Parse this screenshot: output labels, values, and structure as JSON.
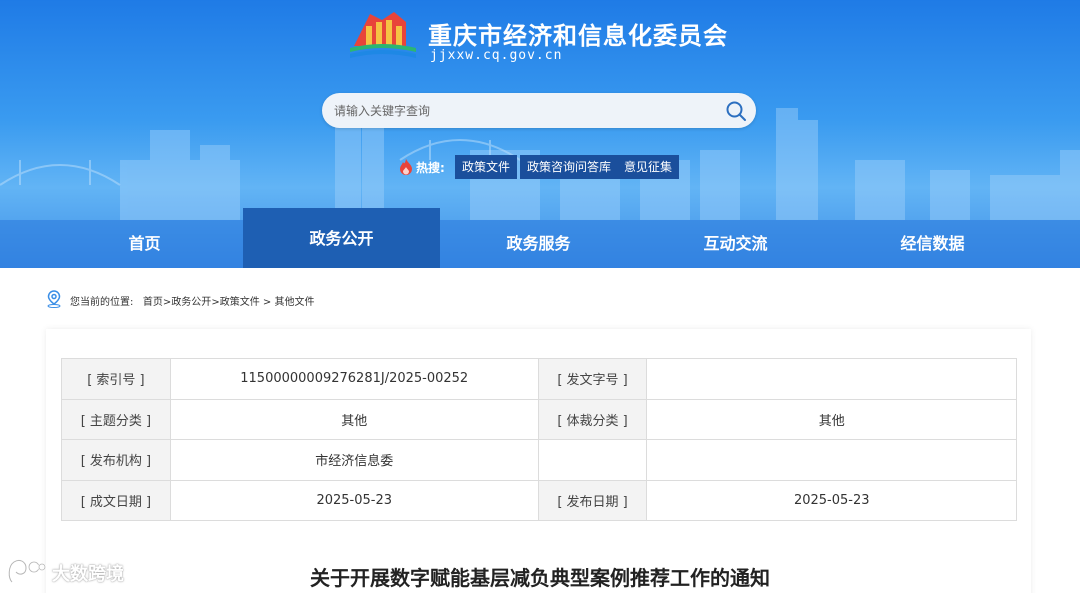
{
  "site": {
    "title": "重庆市经济和信息化委员会",
    "domain": "jjxxw.cq.gov.cn"
  },
  "search": {
    "placeholder": "请输入关键字查询",
    "icon": "search-icon"
  },
  "hot_search": {
    "label": "热搜:",
    "tags": [
      "政策文件",
      "政策咨询问答库",
      "意见征集"
    ]
  },
  "nav": {
    "items": [
      "首页",
      "政务公开",
      "政务服务",
      "互动交流",
      "经信数据"
    ],
    "active": "政务公开"
  },
  "breadcrumb": {
    "prefix": "您当前的位置:",
    "items": [
      "首页",
      "政务公开",
      "政策文件",
      "其他文件"
    ],
    "separators": [
      ">",
      ">",
      " > "
    ]
  },
  "meta_table": {
    "rows": [
      {
        "label1": "[ 索引号 ]",
        "value1": "11500000009276281J/2025-00252",
        "label2": "[ 发文字号 ]",
        "value2": ""
      },
      {
        "label1": "[ 主题分类 ]",
        "value1": "其他",
        "label2": "[ 体裁分类 ]",
        "value2": "其他"
      },
      {
        "label1": "[ 发布机构 ]",
        "value1": "市经济信息委",
        "label2": "",
        "value2": ""
      },
      {
        "label1": "[ 成文日期 ]",
        "value1": "2025-05-23",
        "label2": "[ 发布日期 ]",
        "value2": "2025-05-23"
      }
    ]
  },
  "document": {
    "title": "关于开展数字赋能基层减负典型案例推荐工作的通知"
  },
  "watermark": {
    "text": "大数跨境"
  },
  "colors": {
    "header_top": "#1f7be6",
    "nav_active": "#1e5fb3",
    "hot_tag_bg": "#1a4f9c",
    "label_bg": "#f3f3f3"
  }
}
